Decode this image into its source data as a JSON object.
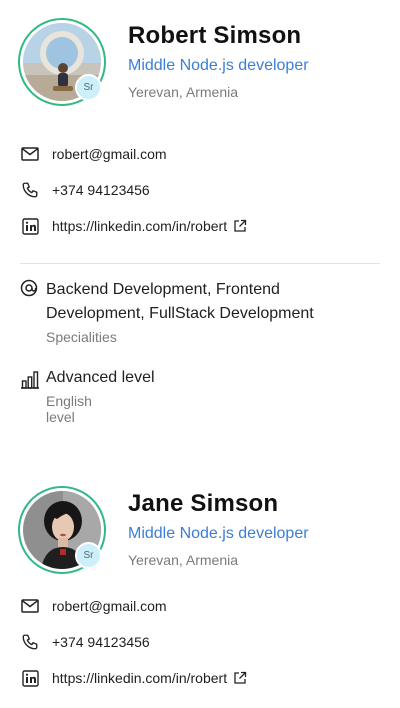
{
  "profiles": [
    {
      "name": "Robert Simson",
      "role": "Middle Node.js developer",
      "location": "Yerevan, Armenia",
      "badge": "Sr",
      "email": "robert@gmail.com",
      "phone": "+374 94123456",
      "linkedin": "https://linkedin.com/in/robert",
      "specialities_value": "Backend Development, Frontend Development, FullStack Development",
      "specialities_label": "Specialities",
      "english_value": "Advanced level",
      "english_label": "English level"
    },
    {
      "name": "Jane Simson",
      "role": "Middle Node.js developer",
      "location": "Yerevan, Armenia",
      "badge": "Sr",
      "email": "robert@gmail.com",
      "phone": "+374 94123456",
      "linkedin": "https://linkedin.com/in/robert"
    }
  ],
  "icons": {
    "email": "mail-icon",
    "phone": "phone-icon",
    "linkedin": "linkedin-icon",
    "external": "external-link-icon",
    "specialities": "at-sign-icon",
    "english": "bar-chart-icon"
  },
  "colors": {
    "accent_blue": "#3b7ed6",
    "ring_green": "#2fb985",
    "badge_bg": "#cdeffa",
    "muted_text": "#7a7a7a"
  }
}
